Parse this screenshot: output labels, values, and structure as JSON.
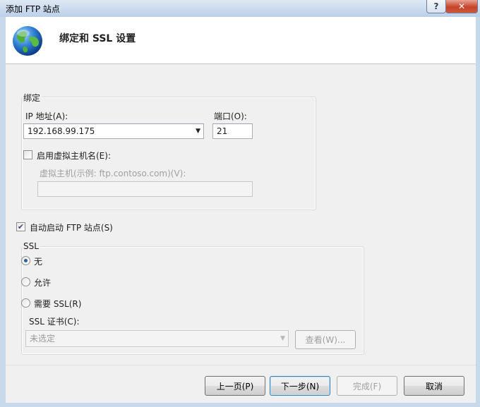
{
  "window": {
    "title": "添加 FTP 站点",
    "help_label": "?",
    "close_label": "✕"
  },
  "header": {
    "title": "绑定和 SSL 设置",
    "icon": "globe-icon"
  },
  "binding": {
    "group_label": "绑定",
    "ip_label": "IP 地址(A):",
    "ip_value": "192.168.99.175",
    "port_label": "端口(O):",
    "port_value": "21",
    "virtual_host_checkbox_label": "启用虚拟主机名(E):",
    "virtual_host_checked": false,
    "virtual_host_field_label": "虚拟主机(示例: ftp.contoso.com)(V):",
    "virtual_host_value": ""
  },
  "autostart": {
    "label": "自动启动 FTP 站点(S)",
    "checked": true
  },
  "ssl": {
    "group_label": "SSL",
    "options": [
      {
        "label": "无",
        "selected": true
      },
      {
        "label": "允许",
        "selected": false
      },
      {
        "label": "需要 SSL(R)",
        "selected": false
      }
    ],
    "cert_label": "SSL 证书(C):",
    "cert_value": "未选定",
    "view_button_label": "查看(W)..."
  },
  "footer": {
    "prev_label": "上一页(P)",
    "next_label": "下一步(N)",
    "finish_label": "完成(F)",
    "cancel_label": "取消"
  },
  "colors": {
    "accent": "#2b5ea8",
    "close_button": "#c7432b",
    "title_bar": "#c9d9ec"
  }
}
